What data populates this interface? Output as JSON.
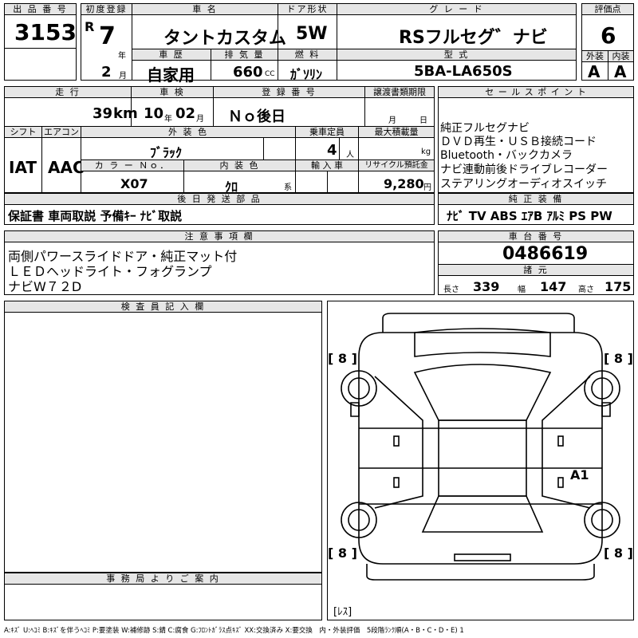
{
  "header": {
    "lot_label": "出 品 番 号",
    "lot_number": "3153",
    "first_reg_label": "初度登録",
    "era": "R",
    "year_number": "7",
    "year_unit": "年",
    "month_number": "2",
    "month_unit": "月",
    "car_name_label": "車 名",
    "car_name": "タントカスタム",
    "door_label": "ドア形状",
    "door": "5W",
    "grade_label": "グ レ ー ド",
    "grade": "RSフルセグ゛ナビ",
    "score_label": "評価点",
    "score": "6",
    "history_label": "車 歴",
    "history": "自家用",
    "displacement_label": "排 気 量",
    "displacement": "660",
    "displacement_unit": "CC",
    "fuel_label": "燃 料",
    "fuel": "ｶﾞｿﾘﾝ",
    "model_label": "型 式",
    "model": "5BA-LA650S",
    "exterior_label": "外装",
    "exterior_grade": "A",
    "interior_label": "内装",
    "interior_grade": "A"
  },
  "row2": {
    "mileage_label": "走 行",
    "mileage": "39",
    "mileage_unit": "km",
    "inspection_label": "車 検",
    "insp_year": "10",
    "insp_year_unit": "年",
    "insp_month": "02",
    "insp_month_unit": "月",
    "registration_label": "登 録 番 号",
    "registration": "Ｎｏ後日",
    "transfer_label": "譲渡書類期限",
    "transfer_month_unit": "月",
    "transfer_day_unit": "日",
    "shift_label": "シフト",
    "aircon_label": "エアコン",
    "shift": "IAT",
    "aircon": "AAC",
    "ext_color_label": "外 装 色",
    "ext_color": "ﾌﾞﾗｯｸ",
    "capacity_label": "乗車定員",
    "capacity": "4",
    "capacity_unit": "人",
    "max_load_label": "最大積載量",
    "max_load_unit": "kg",
    "color_no_label": "カ ラ ー Ｎｏ．",
    "color_no": "X07",
    "int_color_label": "内 装 色",
    "int_color": "ｸﾛ",
    "int_color_suffix": "系",
    "import_label": "輸 入 車",
    "recycle_label": "リサイクル預託金",
    "recycle": "9,280",
    "recycle_unit": "円"
  },
  "sales_points": {
    "label": "セ ー ル ス ポ イ ン ト",
    "lines": [
      "純正フルセグナビ",
      "ＤＶＤ再生・ＵＳＢ接続コード",
      "Bluetooth・バックカメラ",
      "ナビ連動前後ドライブレコーダー",
      "ステアリングオーディオスイッチ"
    ]
  },
  "later_parts": {
    "label": "後 日 発 送 部 品",
    "value": "保証書 車両取説 予備ｷｰ ﾅﾋﾞ取説"
  },
  "equipment": {
    "label": "純 正 装 備",
    "value": "ﾅﾋﾞ TV ABS ｴｱB ｱﾙﾐ PS PW"
  },
  "notes": {
    "label": "注 意 事 項 欄",
    "lines": [
      "両側パワースライドドア・純正マット付",
      "ＬＥＤヘッドライト・フォグランプ",
      "ナビW７２D"
    ]
  },
  "chassis": {
    "label": "車 台 番 号",
    "value": "0486619",
    "dims_label": "諸 元",
    "length_label": "長さ",
    "length": "339",
    "width_label": "幅",
    "width": "147",
    "height_label": "高さ",
    "height": "175"
  },
  "inspector": {
    "label": "検 査 員 記 入 欄"
  },
  "office": {
    "label": "事 務 局 よ り ご 案 内"
  },
  "diagram": {
    "tire_fl": "[ 8 ]",
    "tire_fr": "[ 8 ]",
    "tire_rl": "[ 8 ]",
    "tire_rr": "[ 8 ]",
    "spare": "[ﾚｽ]",
    "mark": "A1"
  },
  "legend": "A:ｷｽﾞ U:ﾍｺﾐ B:ｷｽﾞを伴うﾍｺﾐ P:要塗装 W:補修跡 S:錆 C:腐食 G:ﾌﾛﾝﾄｶﾞﾗｽ点ｷｽﾞ XX:交換済み X:要交換　内・外装評価　5段階ﾗﾝｸ順(A・B・C・D・E) 1"
}
